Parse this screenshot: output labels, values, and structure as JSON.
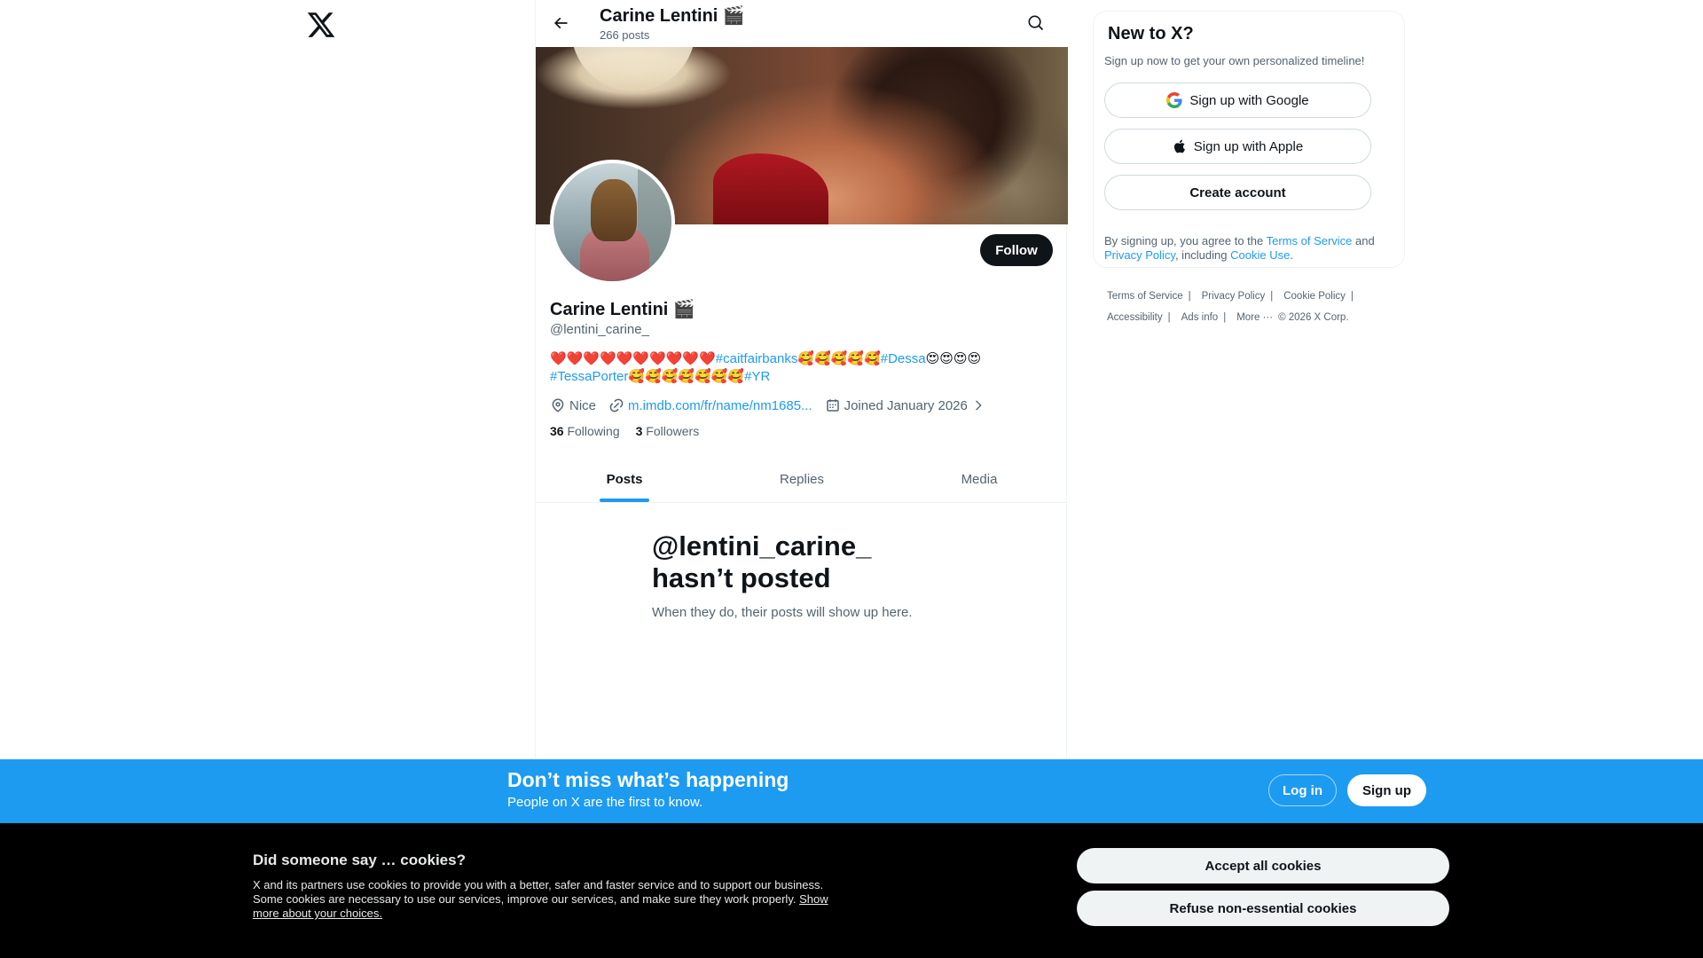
{
  "topbar": {
    "name": "Carine Lentini 🎬",
    "posts_count": "266 posts"
  },
  "profile": {
    "name": "Carine Lentini 🎬",
    "handle": "@lentini_carine_",
    "follow_label": "Follow",
    "bio": {
      "seg1": "❤️❤️❤️❤️❤️❤️❤️❤️❤️❤️",
      "tag1": "#caitfairbanks",
      "seg2": "🥰🥰🥰🥰🥰",
      "tag2": "#Dessa",
      "seg3": "😍😍😍😍",
      "tag3": "#TessaPorter",
      "seg4": "🥰🥰🥰🥰🥰🥰🥰",
      "tag4": "#YR"
    },
    "location": "Nice",
    "website": "m.imdb.com/fr/name/nm1685...",
    "joined": "Joined January 2026",
    "following_count": "36",
    "following_label": "Following",
    "followers_count": "3",
    "followers_label": "Followers"
  },
  "tabs": [
    {
      "label": "Posts",
      "active": true
    },
    {
      "label": "Replies",
      "active": false
    },
    {
      "label": "Media",
      "active": false
    }
  ],
  "empty_state": {
    "title": "@lentini_carine_ hasn’t posted",
    "subtitle": "When they do, their posts will show up here."
  },
  "signup_card": {
    "title": "New to X?",
    "subtitle": "Sign up now to get your own personalized timeline!",
    "google_label": "Sign up with Google",
    "apple_label": "Sign up with Apple",
    "create_label": "Create account",
    "terms_prefix": "By signing up, you agree to the ",
    "terms_link": "Terms of Service",
    "terms_and": " and ",
    "privacy_link": "Privacy Policy",
    "terms_including": ", including ",
    "cookie_link": "Cookie Use",
    "terms_end": "."
  },
  "footer": {
    "terms": "Terms of Service",
    "privacy": "Privacy Policy",
    "cookie": "Cookie Policy",
    "accessibility": "Accessibility",
    "ads": "Ads info",
    "more": "More ···",
    "copyright": "© 2026 X Corp."
  },
  "cta": {
    "title": "Don’t miss what’s happening",
    "subtitle": "People on X are the first to know.",
    "login_label": "Log in",
    "signup_label": "Sign up"
  },
  "cookies": {
    "title": "Did someone say … cookies?",
    "text": "X and its partners use cookies to provide you with a better, safer and faster service and to support our business. Some cookies are necessary to use our services, improve our services, and make sure they work properly. ",
    "link": "Show more about your choices.",
    "accept_label": "Accept all cookies",
    "refuse_label": "Refuse non-essential cookies"
  },
  "colors": {
    "accent": "#1d9bf0",
    "text": "#0f1419",
    "muted": "#536471",
    "cookie_bg": "#000000"
  },
  "icons": [
    "x-logo-icon",
    "back-arrow-icon",
    "search-icon",
    "location-icon",
    "link-icon",
    "calendar-icon",
    "chevron-right-icon",
    "google-icon",
    "apple-icon"
  ]
}
